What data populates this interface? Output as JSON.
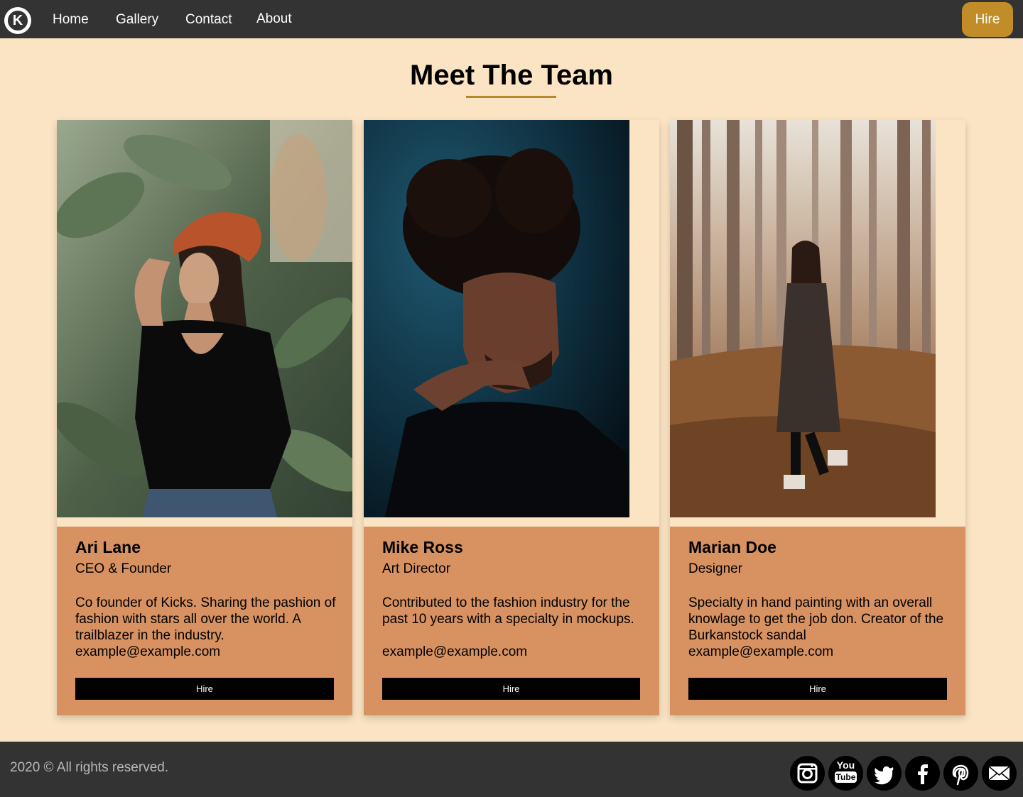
{
  "nav": {
    "logo_letter": "K",
    "links": [
      "Home",
      "Gallery",
      "Contact",
      "About"
    ],
    "hire_label": "Hire"
  },
  "main": {
    "title": "Meet The Team"
  },
  "team": [
    {
      "name": "Ari Lane",
      "role": "CEO & Founder",
      "description": "Co founder of Kicks. Sharing the pashion of fashion with stars all over the world. A trailblazer in the industry.",
      "email": "example@example.com",
      "button_label": "Hire"
    },
    {
      "name": "Mike Ross",
      "role": "Art Director",
      "description": "Contributed to the fashion industry for the past 10 years with a specialty in mockups.",
      "email": "example@example.com",
      "button_label": "Hire"
    },
    {
      "name": "Marian Doe",
      "role": "Designer",
      "description": "Specialty in hand painting with an overall knowlage to get the job don. Creator of the Burkanstock sandal",
      "email": "example@example.com",
      "button_label": "Hire"
    }
  ],
  "footer": {
    "copyright": "2020 © All rights reserved.",
    "social": [
      "instagram-icon",
      "youtube-icon",
      "twitter-icon",
      "facebook-icon",
      "pinterest-icon",
      "email-icon"
    ],
    "youtube_top": "You",
    "youtube_bottom": "Tube"
  },
  "colors": {
    "background": "#fbe4c3",
    "navbar": "#333333",
    "accent": "#c08d29",
    "card_body": "#d89262"
  }
}
